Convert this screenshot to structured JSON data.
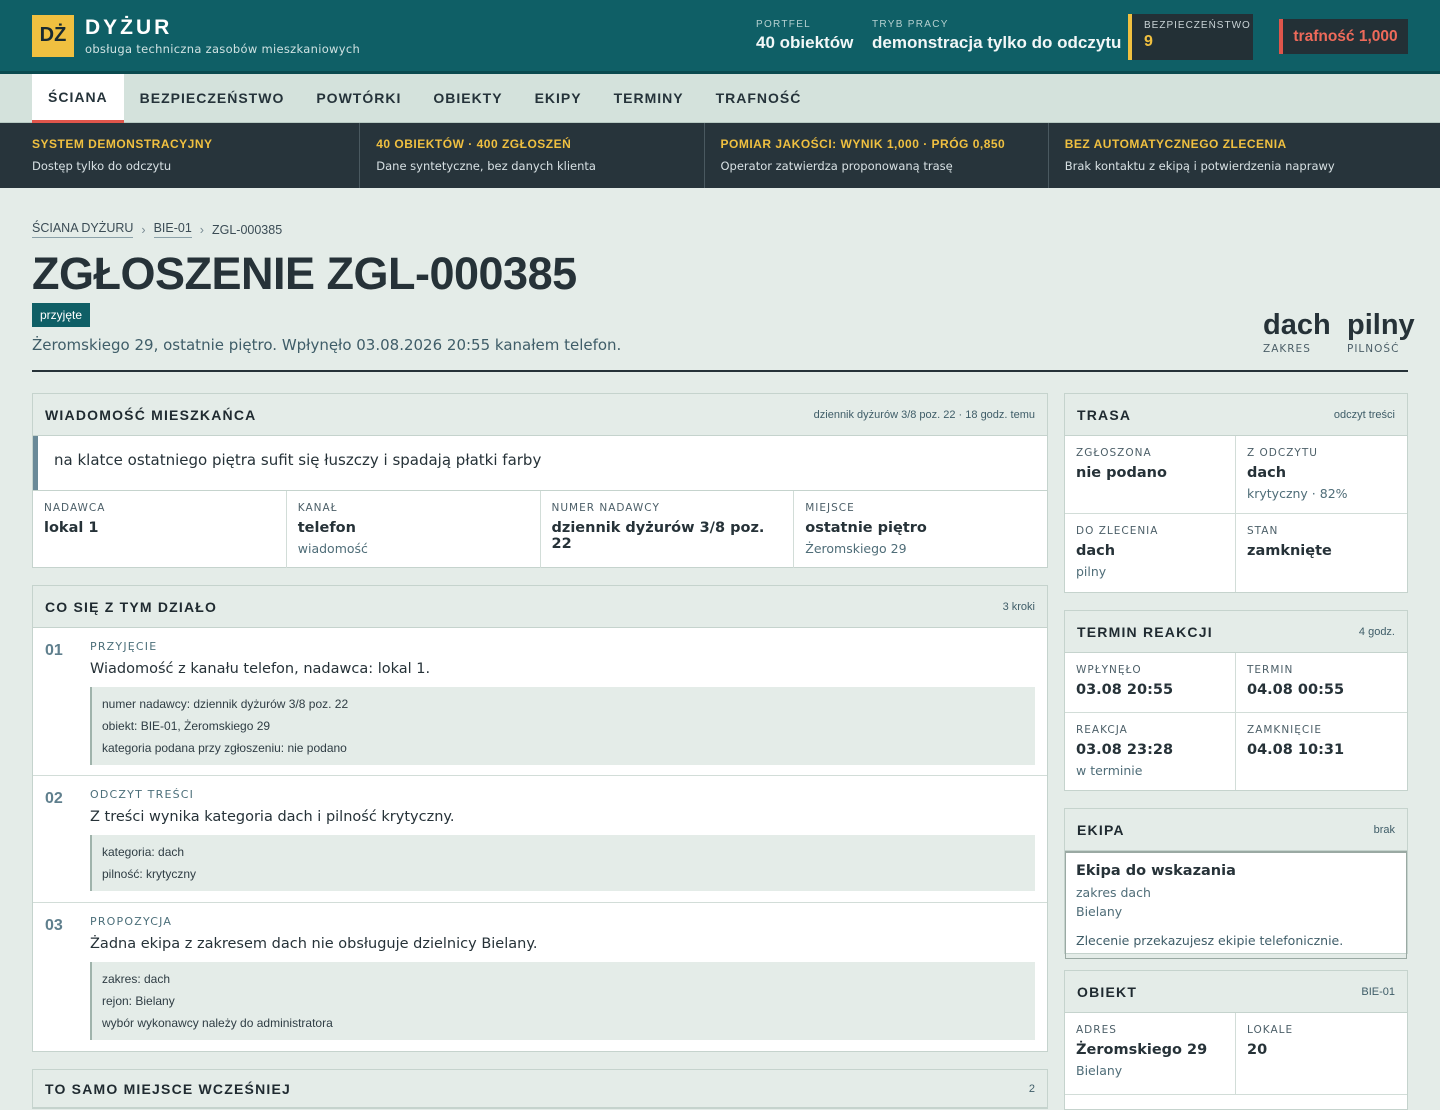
{
  "app": {
    "logo": "DŻ",
    "name": "DYŻUR",
    "subtitle": "obsługa techniczna zasobów mieszkaniowych"
  },
  "header": {
    "portfolio_label": "PORTFEL",
    "portfolio_value": "40 obiektów",
    "mode_label": "TRYB PRACY",
    "mode_value": "demonstracja tylko do odczytu",
    "safety_label": "BEZPIECZEŃSTWO",
    "safety_value": "9",
    "accuracy": "trafność 1,000"
  },
  "tabs": [
    "ŚCIANA",
    "BEZPIECZEŃSTWO",
    "POWTÓRKI",
    "OBIEKTY",
    "EKIPY",
    "TERMINY",
    "TRAFNOŚĆ"
  ],
  "infobar": [
    {
      "title": "SYSTEM DEMONSTRACYJNY",
      "desc": "Dostęp tylko do odczytu"
    },
    {
      "title": "40 OBIEKTÓW · 400 ZGŁOSZEŃ",
      "desc": "Dane syntetyczne, bez danych klienta"
    },
    {
      "title": "POMIAR JAKOŚCI: WYNIK 1,000 · PRÓG 0,850",
      "desc": "Operator zatwierdza proponowaną trasę"
    },
    {
      "title": "BEZ AUTOMATYCZNEGO ZLECENIA",
      "desc": "Brak kontaktu z ekipą i potwierdzenia naprawy"
    }
  ],
  "breadcrumb": [
    "ŚCIANA DYŻURU",
    "BIE-01",
    "ZGL-000385"
  ],
  "page": {
    "title": "ZGŁOSZENIE ZGL-000385",
    "status": "przyjęte",
    "summary": "Żeromskiego 29, ostatnie piętro. Wpłynęło 03.08.2026 20:55 kanałem telefon.",
    "scope_value": "dach",
    "scope_label": "ZAKRES",
    "urgency_value": "pilny",
    "urgency_label": "PILNOŚĆ"
  },
  "message": {
    "heading": "WIADOMOŚĆ MIESZKAŃCA",
    "meta": "dziennik dyżurów 3/8 poz. 22 · 18 godz. temu",
    "text": "na klatce ostatniego piętra sufit się łuszczy i spadają płatki farby",
    "fields": [
      {
        "label": "NADAWCA",
        "value": "lokal 1",
        "sub": ""
      },
      {
        "label": "KANAŁ",
        "value": "telefon",
        "sub": "wiadomość"
      },
      {
        "label": "NUMER NADAWCY",
        "value": "dziennik dyżurów 3/8 poz. 22",
        "sub": ""
      },
      {
        "label": "MIEJSCE",
        "value": "ostatnie piętro",
        "sub": "Żeromskiego 29"
      }
    ]
  },
  "history": {
    "heading": "CO SIĘ Z TYM DZIAŁO",
    "meta": "3 kroki",
    "steps": [
      {
        "num": "01",
        "label": "PRZYJĘCIE",
        "text": "Wiadomość z kanału telefon, nadawca: lokal 1.",
        "details": [
          "numer nadawcy: dziennik dyżurów 3/8 poz. 22",
          "obiekt: BIE-01, Żeromskiego 29",
          "kategoria podana przy zgłoszeniu: nie podano"
        ]
      },
      {
        "num": "02",
        "label": "ODCZYT TREŚCI",
        "text": "Z treści wynika kategoria dach i pilność krytyczny.",
        "details": [
          "kategoria: dach",
          "pilność: krytyczny"
        ]
      },
      {
        "num": "03",
        "label": "PROPOZYCJA",
        "text": "Żadna ekipa z zakresem dach nie obsługuje dzielnicy Bielany.",
        "details": [
          "zakres: dach",
          "rejon: Bielany",
          "wybór wykonawcy należy do administratora"
        ]
      }
    ]
  },
  "earlier": {
    "heading": "TO SAMO MIEJSCE WCZEŚNIEJ",
    "meta": "2"
  },
  "route": {
    "heading": "TRASA",
    "meta": "odczyt treści",
    "cells": [
      {
        "label": "ZGŁOSZONA",
        "value": "nie podano",
        "sub": ""
      },
      {
        "label": "Z ODCZYTU",
        "value": "dach",
        "sub": "krytyczny · 82%"
      },
      {
        "label": "DO ZLECENIA",
        "value": "dach",
        "sub": "pilny"
      },
      {
        "label": "STAN",
        "value": "zamknięte",
        "sub": ""
      }
    ]
  },
  "deadline": {
    "heading": "TERMIN REAKCJI",
    "meta": "4 godz.",
    "cells": [
      {
        "label": "WPŁYNĘŁO",
        "value": "03.08 20:55",
        "sub": ""
      },
      {
        "label": "TERMIN",
        "value": "04.08 00:55",
        "sub": ""
      },
      {
        "label": "REAKCJA",
        "value": "03.08 23:28",
        "sub": "w terminie"
      },
      {
        "label": "ZAMKNIĘCIE",
        "value": "04.08 10:31",
        "sub": ""
      }
    ]
  },
  "crew": {
    "heading": "EKIPA",
    "meta": "brak",
    "name": "Ekipa do wskazania",
    "scope": "zakres dach",
    "district": "Bielany",
    "note": "Zlecenie przekazujesz ekipie telefonicznie."
  },
  "building": {
    "heading": "OBIEKT",
    "meta": "BIE-01",
    "cells": [
      {
        "label": "ADRES",
        "value": "Żeromskiego 29",
        "sub": "Bielany"
      },
      {
        "label": "LOKALE",
        "value": "20",
        "sub": ""
      }
    ]
  }
}
